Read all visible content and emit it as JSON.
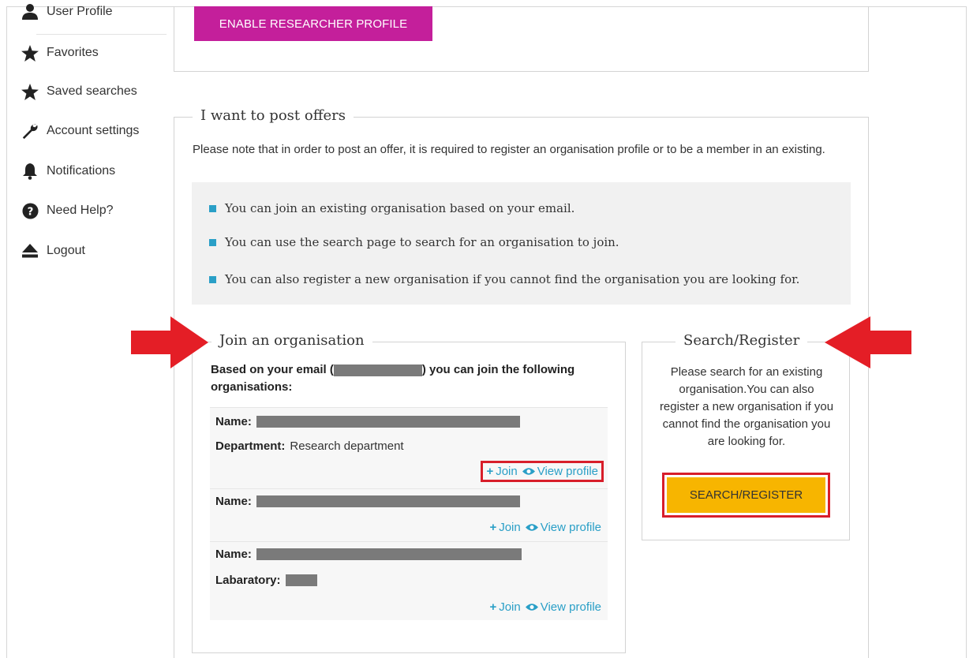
{
  "sidebar": {
    "items": [
      {
        "label": "User Profile",
        "icon": "user-icon"
      },
      {
        "label": "Favorites",
        "icon": "star-icon"
      },
      {
        "label": "Saved searches",
        "icon": "star-icon"
      },
      {
        "label": "Account settings",
        "icon": "wrench-icon"
      },
      {
        "label": "Notifications",
        "icon": "bell-icon"
      },
      {
        "label": "Need Help?",
        "icon": "question-circle-icon"
      },
      {
        "label": "Logout",
        "icon": "eject-icon"
      }
    ]
  },
  "researcher": {
    "button_label": "ENABLE RESEARCHER PROFILE"
  },
  "offers": {
    "legend": "I want to post offers",
    "note": "Please note that in order to post an offer, it is required to register an organisation profile or to be a member in an existing.",
    "bullets": [
      "You can join an existing organisation based on your email.",
      "You can use the search page to search for an organisation to join.",
      "You can also register a new organisation if you cannot find the organisation you are looking for."
    ]
  },
  "join": {
    "legend": "Join an organisation",
    "intro_prefix": "Based on your email (",
    "intro_suffix": ") you can join the following organisations:",
    "name_label": "Name:",
    "join_label": "Join",
    "view_label": "View profile",
    "orgs": [
      {
        "extra_label": "Department:",
        "extra_value": "Research department"
      },
      {
        "extra_label": "",
        "extra_value": ""
      },
      {
        "extra_label": "Labaratory:",
        "extra_value": ""
      }
    ]
  },
  "search": {
    "legend": "Search/Register",
    "text": "Please search for an existing organisation.You can also register a new organisation if you cannot find the organisation you are looking for.",
    "button_label": "SEARCH/REGISTER"
  },
  "colors": {
    "researcher_button": "#c41f9b",
    "search_button": "#f7b500",
    "accent": "#2a9fc7",
    "highlight": "#d81e2a"
  }
}
